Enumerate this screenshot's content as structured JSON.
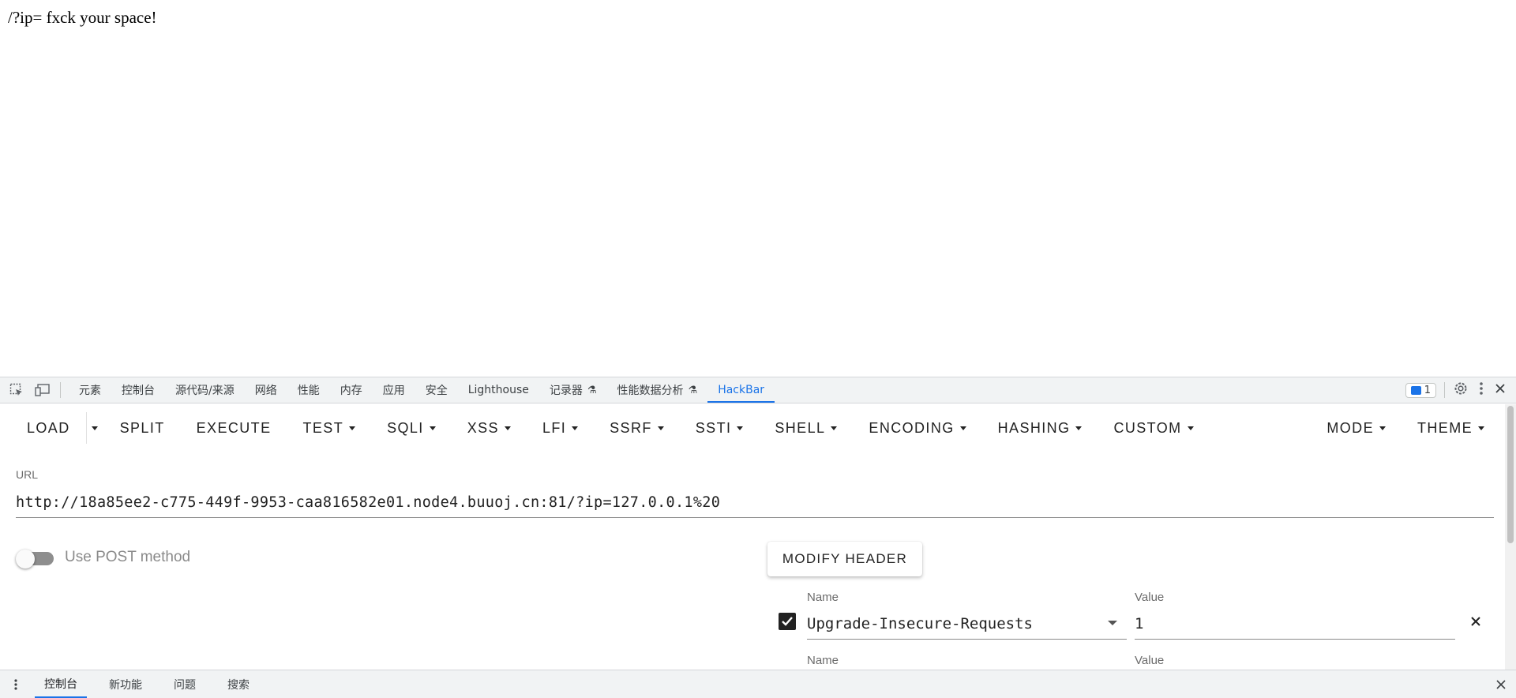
{
  "page": {
    "message": "/?ip= fxck your space!"
  },
  "devtools": {
    "tabs": [
      {
        "label": "元素"
      },
      {
        "label": "控制台"
      },
      {
        "label": "源代码/来源"
      },
      {
        "label": "网络"
      },
      {
        "label": "性能"
      },
      {
        "label": "内存"
      },
      {
        "label": "应用"
      },
      {
        "label": "安全"
      },
      {
        "label": "Lighthouse"
      },
      {
        "label": "记录器"
      },
      {
        "label": "性能数据分析"
      },
      {
        "label": "HackBar"
      }
    ],
    "active_tab": "HackBar",
    "issues_count": "1",
    "accent_color": "#1a73e8"
  },
  "hackbar": {
    "toolbar": {
      "load": "LOAD",
      "split": "SPLIT",
      "execute": "EXECUTE",
      "test": "TEST",
      "sqli": "SQLI",
      "xss": "XSS",
      "lfi": "LFI",
      "ssrf": "SSRF",
      "ssti": "SSTI",
      "shell": "SHELL",
      "encoding": "ENCODING",
      "hashing": "HASHING",
      "custom": "CUSTOM",
      "mode": "MODE",
      "theme": "THEME"
    },
    "url_label": "URL",
    "url_value": "http://18a85ee2-c775-449f-9953-caa816582e01.node4.buuoj.cn:81/?ip=127.0.0.1%20",
    "post_toggle_label": "Use POST method",
    "post_enabled": false,
    "modify_header_label": "MODIFY HEADER",
    "headers": [
      {
        "name_label": "Name",
        "value_label": "Value",
        "name": "Upgrade-Insecure-Requests",
        "value": "1",
        "enabled": true
      },
      {
        "name_label": "Name",
        "value_label": "Value"
      }
    ]
  },
  "drawer": {
    "tabs": [
      {
        "label": "控制台"
      },
      {
        "label": "新功能"
      },
      {
        "label": "问题"
      },
      {
        "label": "搜索"
      }
    ],
    "active_tab": "控制台"
  }
}
